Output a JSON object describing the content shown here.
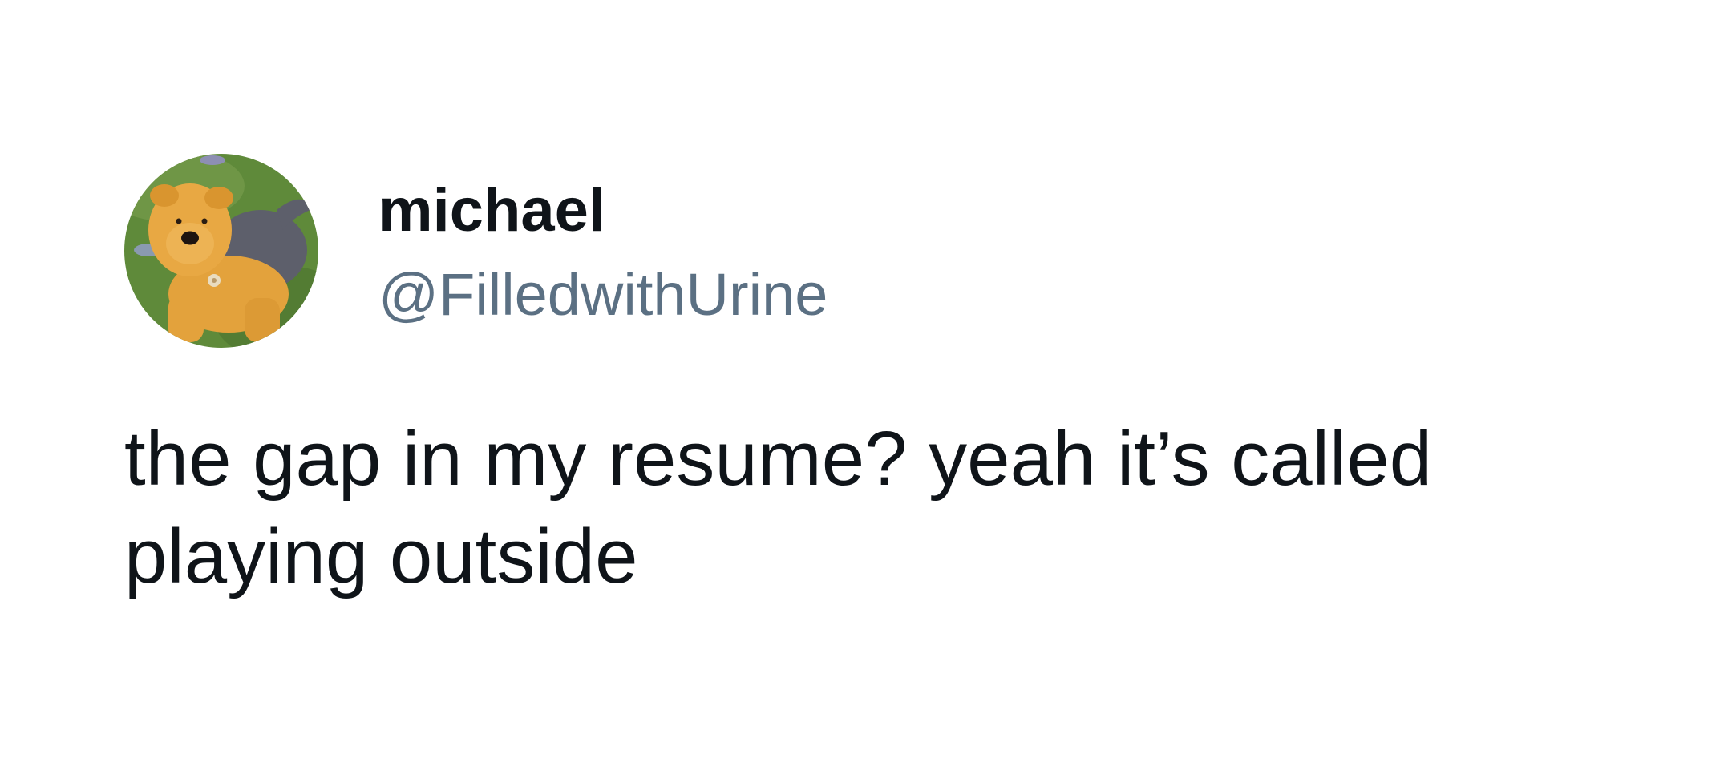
{
  "tweet": {
    "author": {
      "display_name": "michael",
      "handle": "@FilledwithUrine",
      "avatar_icon": "plush-dog-avatar"
    },
    "text": "the gap in my resume? yeah it’s called playing outside"
  },
  "colors": {
    "background": "#ffffff",
    "name": "#0f1419",
    "handle": "#5b7083",
    "text": "#0f1419"
  }
}
